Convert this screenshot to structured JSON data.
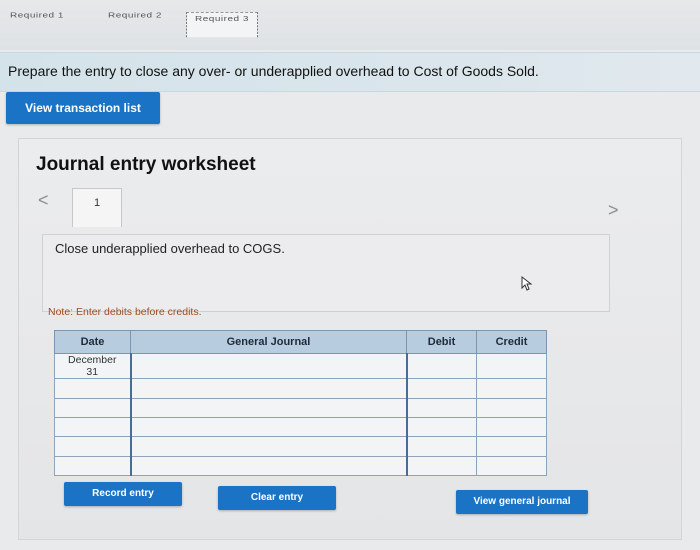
{
  "tabs": [
    {
      "label": "Required 1"
    },
    {
      "label": "Required 2"
    },
    {
      "label": "Required 3"
    }
  ],
  "instruction": "Prepare the entry to close any over- or underapplied overhead to Cost of Goods Sold.",
  "view_transaction_list_label": "View transaction list",
  "worksheet": {
    "title": "Journal entry worksheet",
    "prev_arrow": "<",
    "next_arrow": ">",
    "entry_tab": "1",
    "description": "Close underapplied overhead to COGS.",
    "note": "Note: Enter debits before credits."
  },
  "table": {
    "headers": {
      "date": "Date",
      "account": "General Journal",
      "debit": "Debit",
      "credit": "Credit"
    },
    "first_date": "December\n31"
  },
  "buttons": {
    "record": "Record entry",
    "clear": "Clear entry",
    "view_general_journal": "View general journal"
  },
  "colors": {
    "primary_button": "#1a73c4",
    "table_header": "#b8cce0",
    "note_text": "#9a4d22"
  }
}
